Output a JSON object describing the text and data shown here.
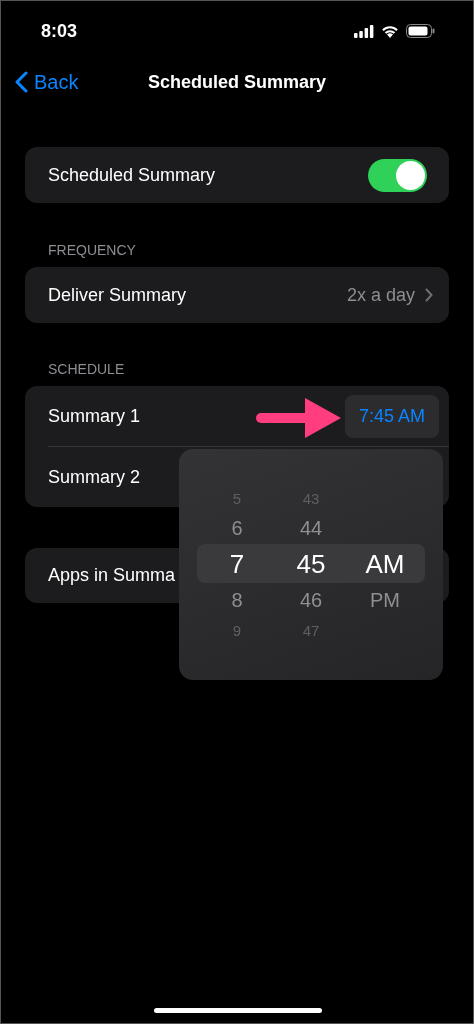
{
  "status_bar": {
    "time": "8:03"
  },
  "nav": {
    "back": "Back",
    "title": "Scheduled Summary"
  },
  "toggle_row": {
    "label": "Scheduled Summary",
    "on": true
  },
  "frequency": {
    "header": "FREQUENCY",
    "label": "Deliver Summary",
    "value": "2x a day"
  },
  "schedule": {
    "header": "SCHEDULE",
    "rows": [
      {
        "label": "Summary 1",
        "time": "7:45 AM"
      },
      {
        "label": "Summary 2"
      }
    ]
  },
  "apps_row": {
    "label": "Apps in Summa"
  },
  "picker": {
    "columns": [
      {
        "items": [
          {
            "label": "5",
            "selected": false
          },
          {
            "label": "6",
            "selected": false
          },
          {
            "label": "7",
            "selected": true
          },
          {
            "label": "8",
            "selected": false
          },
          {
            "label": "9",
            "selected": false
          }
        ]
      },
      {
        "items": [
          {
            "label": "43",
            "selected": false
          },
          {
            "label": "44",
            "selected": false
          },
          {
            "label": "45",
            "selected": true
          },
          {
            "label": "46",
            "selected": false
          },
          {
            "label": "47",
            "selected": false
          }
        ]
      },
      {
        "items": [
          {
            "label": "AM",
            "selected": true
          },
          {
            "label": "PM",
            "selected": false
          }
        ]
      }
    ]
  }
}
